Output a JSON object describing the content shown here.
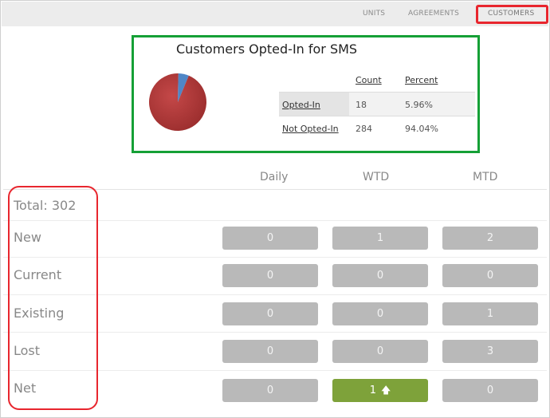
{
  "tabs": [
    {
      "label": "UNITS"
    },
    {
      "label": "AGREEMENTS"
    },
    {
      "label": "CUSTOMERS"
    }
  ],
  "sms": {
    "title": "Customers Opted-In for SMS",
    "columns": [
      "Count",
      "Percent"
    ],
    "rows": [
      {
        "label": "Opted-In",
        "count": "18",
        "percent": "5.96%"
      },
      {
        "label": "Not Opted-In",
        "count": "284",
        "percent": "94.04%"
      }
    ],
    "chart_colors": {
      "opted_in": "#4f86c6",
      "not_opted_in": "#b83a3a"
    }
  },
  "chart_data": {
    "type": "pie",
    "categories": [
      "Opted-In",
      "Not Opted-In"
    ],
    "values": [
      5.96,
      94.04
    ]
  },
  "periods": [
    "Daily",
    "WTD",
    "MTD"
  ],
  "total_label": "Total: 302",
  "metrics": [
    {
      "label": "New",
      "daily": "0",
      "wtd": "1",
      "mtd": "2"
    },
    {
      "label": "Current",
      "daily": "0",
      "wtd": "0",
      "mtd": "0"
    },
    {
      "label": "Existing",
      "daily": "0",
      "wtd": "0",
      "mtd": "1"
    },
    {
      "label": "Lost",
      "daily": "0",
      "wtd": "0",
      "mtd": "3"
    },
    {
      "label": "Net",
      "daily": "0",
      "wtd": "1",
      "mtd": "0",
      "wtd_icon": "arrow-up-icon"
    }
  ],
  "colors": {
    "accent_green": "#7ea23a",
    "highlight_red": "#e8262e",
    "panel_green": "#15a036"
  }
}
